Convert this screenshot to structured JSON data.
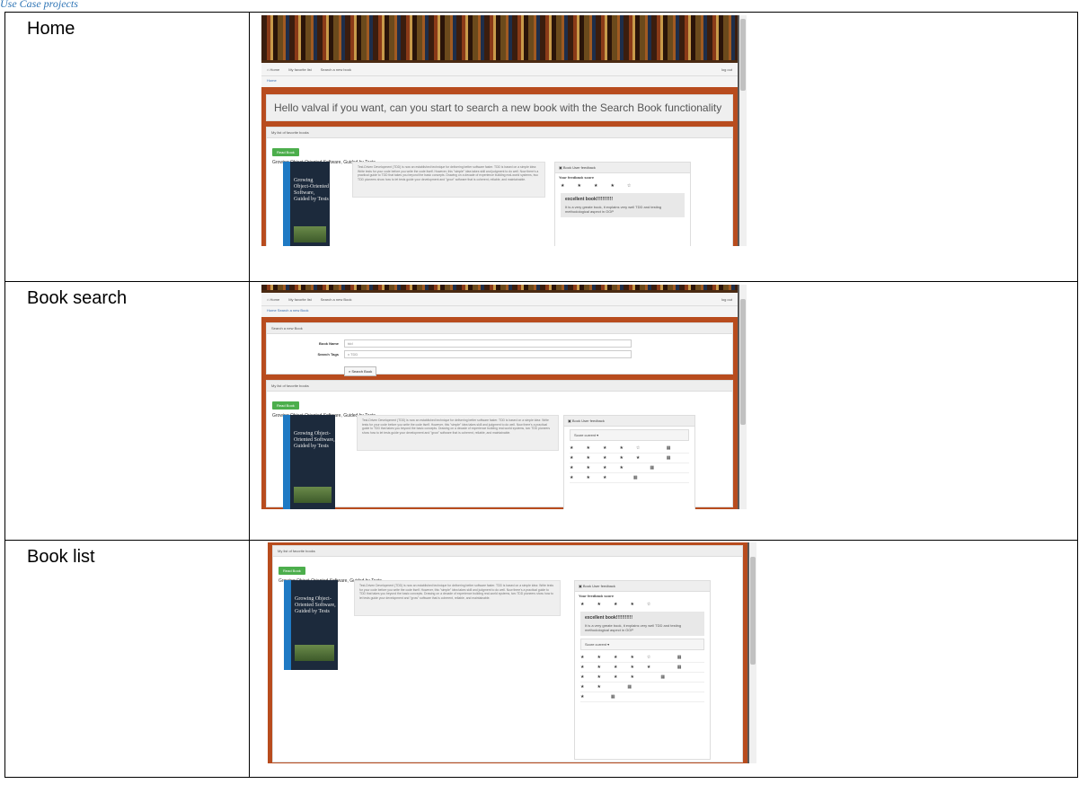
{
  "caption_fragment": "Use Case projects",
  "rows": [
    {
      "label": "Home",
      "nav": {
        "home": "Home",
        "list": "My favorite list",
        "search": "Search a new book",
        "logout": "log out"
      },
      "crumbs": "Home",
      "hello": "Hello valval if you want, can you start to search a new book with the Search Book functionality",
      "panel_title": "My list of favorite books",
      "read_button": "Read Book",
      "book_title": "Growing Object-Oriented Software, Guided by Tests",
      "cover_text": "Growing Object-Oriented Software, Guided by Tests",
      "description": "Test-Driven Development (TDD) is now an established technique for delivering better software faster. TDD is based on a simple idea: Write tests for your code before you write the code itself. However, this \"simple\" idea takes skill and judgment to do well. Now there's a practical guide to TDD that takes you beyond the basic concepts. Drawing on a decade of experience building real-world systems, two TDD pioneers show how to let tests guide your development and \"grow\" software that is coherent, reliable, and maintainable.",
      "feedback_title": "Book User feedback",
      "feedback_score_label": "Your feedback score",
      "stars": "★★★★☆",
      "review_title": "excellent book!!!!!!!!!!!",
      "review_text": "It is a very greate book, it explains very well TDD and testing methodological aspect in OOP"
    },
    {
      "label": "Book search",
      "nav": {
        "home": "Home",
        "list": "My favorite list",
        "search": "Search a new Book",
        "logout": "log out"
      },
      "crumbs": "Home  Search a new Book",
      "search_panel_title": "Search a new Book",
      "book_name_label": "Book Name",
      "book_name_value": "tdd",
      "search_tags_label": "Search Tags",
      "search_tags_value": "x TDD",
      "search_button": "Search Book",
      "panel_title": "My list of favorite books",
      "read_button": "Read Book",
      "book_title": "Growing Object-Oriented Software, Guided by Tests",
      "cover_text": "Growing Object-Oriented Software, Guided by Tests",
      "description": "Test-Driven Development (TDD) is now an established technique for delivering better software faster. TDD is based on a simple idea: Write tests for your code before you write the code itself. However, this \"simple\" idea takes skill and judgment to do well. Now there's a practical guide to TDD that takes you beyond the basic concepts. Drawing on a decade of experience building real-world systems, two TDD pioneers show how to let tests guide your development and \"grow\" software that is coherent, reliable, and maintainable.",
      "feedback_title": "Book User feedback",
      "score_current": "Score current",
      "star_rows": [
        "★★★★☆ ▦",
        "★★★★★ ▦",
        "★★★★ ▦",
        "★★★ ▦"
      ]
    },
    {
      "label": "Book list",
      "panel_title": "My list of favorite books",
      "read_button": "Read Book",
      "book_title": "Growing Object-Oriented Software, Guided by Tests",
      "cover_text": "Growing Object-Oriented Software, Guided by Tests",
      "description": "Test-Driven Development (TDD) is now an established technique for delivering better software faster. TDD is based on a simple idea: Write tests for your code before you write the code itself. However, this \"simple\" idea takes skill and judgment to do well. Now there's a practical guide to TDD that takes you beyond the basic concepts. Drawing on a decade of experience building real-world systems, two TDD pioneers show how to let tests guide your development and \"grow\" software that is coherent, reliable, and maintainable.",
      "feedback_title": "Book User feedback",
      "feedback_score_label": "Your feedback score",
      "stars": "★★★★☆",
      "review_title": "excellent book!!!!!!!!!!!",
      "review_text": "It is a very greate book, it explains very well TDD and testing methodological aspect in OOP",
      "score_current": "Score current",
      "star_rows": [
        "★★★★☆ ▦",
        "★★★★★ ▦",
        "★★★★ ▦",
        "★★ ▦",
        "★ ▦"
      ]
    }
  ]
}
